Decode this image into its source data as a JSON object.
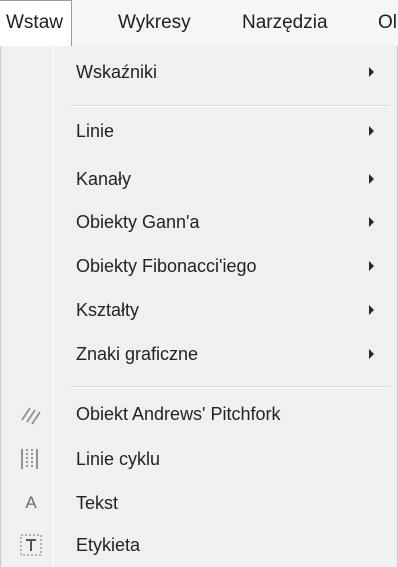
{
  "menubar": {
    "items": [
      {
        "label": "Wstaw",
        "active": true
      },
      {
        "label": "Wykresy",
        "active": false
      },
      {
        "label": "Narzędzia",
        "active": false
      },
      {
        "label": "Ol",
        "active": false
      }
    ]
  },
  "dropdown": {
    "items": [
      {
        "label": "Wskaźniki",
        "has_submenu": true
      },
      {
        "label": "Linie",
        "has_submenu": true
      },
      {
        "label": "Kanały",
        "has_submenu": true
      },
      {
        "label": "Obiekty Gann'a",
        "has_submenu": true
      },
      {
        "label": "Obiekty Fibonacci'iego",
        "has_submenu": true
      },
      {
        "label": "Kształty",
        "has_submenu": true
      },
      {
        "label": "Znaki graficzne",
        "has_submenu": true
      },
      {
        "label": "Obiekt Andrews' Pitchfork",
        "has_submenu": false,
        "icon": "pitchfork-icon"
      },
      {
        "label": "Linie cyklu",
        "has_submenu": false,
        "icon": "cycle-lines-icon"
      },
      {
        "label": "Tekst",
        "has_submenu": false,
        "icon": "text-icon",
        "icon_glyph": "A"
      },
      {
        "label": "Etykieta",
        "has_submenu": false,
        "icon": "label-icon"
      }
    ]
  },
  "colors": {
    "menubar_bg": "#f5f6f8",
    "menu_bg": "#f0f0f0",
    "text": "#222222",
    "icon_gray": "#6a6a6a"
  }
}
